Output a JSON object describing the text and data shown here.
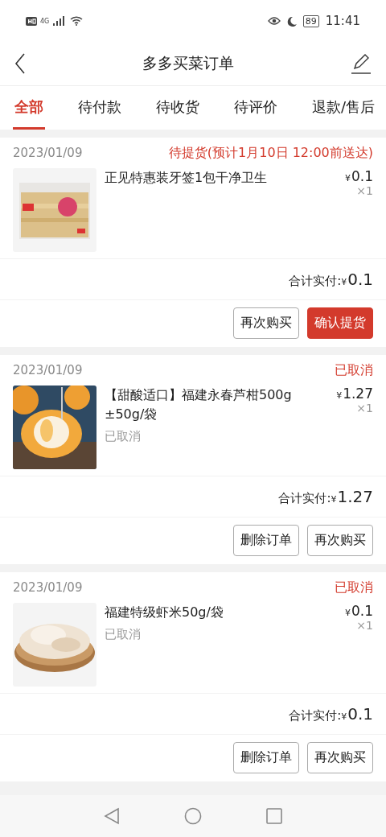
{
  "status_bar": {
    "network": "4G",
    "battery": "89",
    "time": "11:41"
  },
  "header": {
    "title": "多多买菜订单"
  },
  "tabs": [
    {
      "label": "全部",
      "selected": true
    },
    {
      "label": "待付款",
      "selected": false
    },
    {
      "label": "待收货",
      "selected": false
    },
    {
      "label": "待评价",
      "selected": false
    },
    {
      "label": "退款/售后",
      "selected": false
    }
  ],
  "orders": [
    {
      "date": "2023/01/09",
      "status": "待提货(预计1月10日 12:00前送达)",
      "item": {
        "kind": "picture",
        "name": "正见特惠装牙签1包干净卫生",
        "currency": "¥",
        "price": "0.1",
        "quantity": "×1"
      },
      "total_label": "合计实付:",
      "total_currency": "¥",
      "total": "0.1",
      "buttons": [
        {
          "label": "再次购买",
          "kind": "outline"
        },
        {
          "label": "确认提货",
          "kind": "primary"
        }
      ]
    },
    {
      "date": "2023/01/09",
      "status": "已取消",
      "item": {
        "kind": "picture",
        "name": "【甜酸适口】福建永春芦柑500g ±50g/袋",
        "note": "已取消",
        "currency": "¥",
        "price": "1.27",
        "quantity": "×1"
      },
      "total_label": "合计实付:",
      "total_currency": "¥",
      "total": "1.27",
      "buttons": [
        {
          "label": "删除订单",
          "kind": "outline"
        },
        {
          "label": "再次购买",
          "kind": "outline"
        }
      ]
    },
    {
      "date": "2023/01/09",
      "status": "已取消",
      "item": {
        "kind": "picture",
        "name": "福建特级虾米50g/袋",
        "note": "已取消",
        "currency": "¥",
        "price": "0.1",
        "quantity": "×1"
      },
      "total_label": "合计实付:",
      "total_currency": "¥",
      "total": "0.1",
      "buttons": [
        {
          "label": "删除订单",
          "kind": "outline"
        },
        {
          "label": "再次购买",
          "kind": "outline"
        }
      ]
    }
  ]
}
